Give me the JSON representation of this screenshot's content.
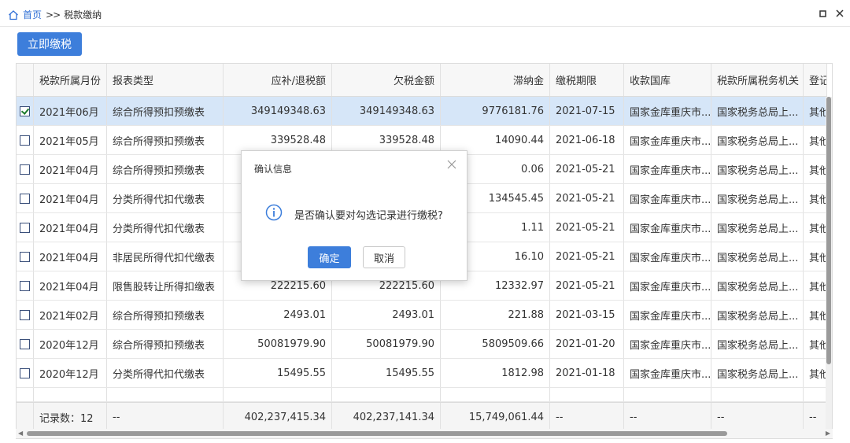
{
  "breadcrumb": {
    "home": "首页",
    "separator": ">>",
    "current": "税款缴纳"
  },
  "toolbar": {
    "pay_now": "立即缴税"
  },
  "table": {
    "headers": [
      "税款所属月份",
      "报表类型",
      "应补/退税额",
      "欠税金额",
      "滞纳金",
      "缴税期限",
      "收款国库",
      "税款所属税务机关",
      "登记"
    ],
    "rows": [
      {
        "checked": true,
        "cells": [
          "2021年06月",
          "综合所得预扣预缴表",
          "349149348.63",
          "349149348.63",
          "9776181.76",
          "2021-07-15",
          "国家金库重庆市...",
          "国家税务总局上...",
          "其他"
        ]
      },
      {
        "checked": false,
        "cells": [
          "2021年05月",
          "综合所得预扣预缴表",
          "339528.48",
          "339528.48",
          "14090.44",
          "2021-06-18",
          "国家金库重庆市...",
          "国家税务总局上...",
          "其他"
        ]
      },
      {
        "checked": false,
        "cells": [
          "2021年04月",
          "综合所得预扣预缴表",
          "",
          "",
          "0.06",
          "2021-05-21",
          "国家金库重庆市...",
          "国家税务总局上...",
          "其他"
        ]
      },
      {
        "checked": false,
        "cells": [
          "2021年04月",
          "分类所得代扣代缴表",
          "",
          "",
          "134545.45",
          "2021-05-21",
          "国家金库重庆市...",
          "国家税务总局上...",
          "其他"
        ]
      },
      {
        "checked": false,
        "cells": [
          "2021年04月",
          "分类所得代扣代缴表",
          "",
          "",
          "1.11",
          "2021-05-21",
          "国家金库重庆市...",
          "国家税务总局上...",
          "其他"
        ]
      },
      {
        "checked": false,
        "cells": [
          "2021年04月",
          "非居民所得代扣代缴表",
          "",
          "",
          "16.10",
          "2021-05-21",
          "国家金库重庆市...",
          "国家税务总局上...",
          "其他"
        ]
      },
      {
        "checked": false,
        "cells": [
          "2021年04月",
          "限售股转让所得扣缴表",
          "222215.60",
          "222215.60",
          "12332.97",
          "2021-05-21",
          "国家金库重庆市...",
          "国家税务总局上...",
          "其他"
        ]
      },
      {
        "checked": false,
        "cells": [
          "2021年02月",
          "综合所得预扣预缴表",
          "2493.01",
          "2493.01",
          "221.88",
          "2021-03-15",
          "国家金库重庆市...",
          "国家税务总局上...",
          "其他"
        ]
      },
      {
        "checked": false,
        "cells": [
          "2020年12月",
          "综合所得预扣预缴表",
          "50081979.90",
          "50081979.90",
          "5809509.66",
          "2021-01-20",
          "国家金库重庆市...",
          "国家税务总局上...",
          "其他"
        ]
      },
      {
        "checked": false,
        "cells": [
          "2020年12月",
          "分类所得代扣代缴表",
          "15495.55",
          "15495.55",
          "1812.98",
          "2021-01-18",
          "国家金库重庆市...",
          "国家税务总局上...",
          "其他"
        ]
      }
    ],
    "footer": [
      "记录数：12",
      "--",
      "402,237,415.34",
      "402,237,141.34",
      "15,749,061.44",
      "--",
      "--",
      "--",
      "--"
    ]
  },
  "dialog": {
    "title": "确认信息",
    "message": "是否确认要对勾选记录进行缴税?",
    "ok": "确定",
    "cancel": "取消"
  },
  "colors": {
    "accent": "#3d7edb",
    "selected_row": "#d6e6f8"
  }
}
